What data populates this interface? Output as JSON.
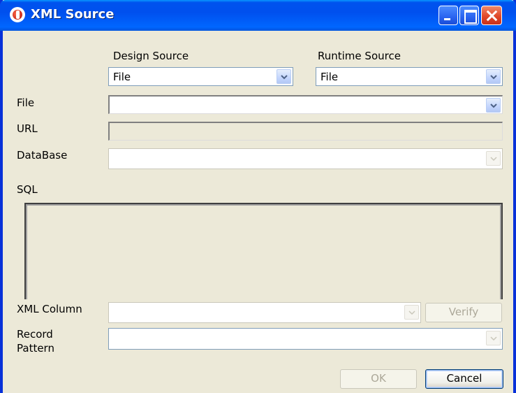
{
  "window": {
    "title": "XML Source"
  },
  "design_source": {
    "label": "Design Source",
    "value": "File"
  },
  "runtime_source": {
    "label": "Runtime Source",
    "value": "File"
  },
  "file": {
    "label": "File",
    "value": ""
  },
  "url": {
    "label": "URL",
    "value": ""
  },
  "database": {
    "label": "DataBase",
    "value": ""
  },
  "sql": {
    "label": "SQL",
    "value": ""
  },
  "xml_column": {
    "label": "XML Column",
    "value": "",
    "verify_label": "Verify"
  },
  "record_pattern": {
    "label_line1": "Record",
    "label_line2": "Pattern",
    "value": ""
  },
  "buttons": {
    "ok": "OK",
    "cancel": "Cancel"
  },
  "colors": {
    "titlebar": "#0053ee",
    "window_bg": "#ece9d8",
    "disabled_text": "#aca899"
  }
}
